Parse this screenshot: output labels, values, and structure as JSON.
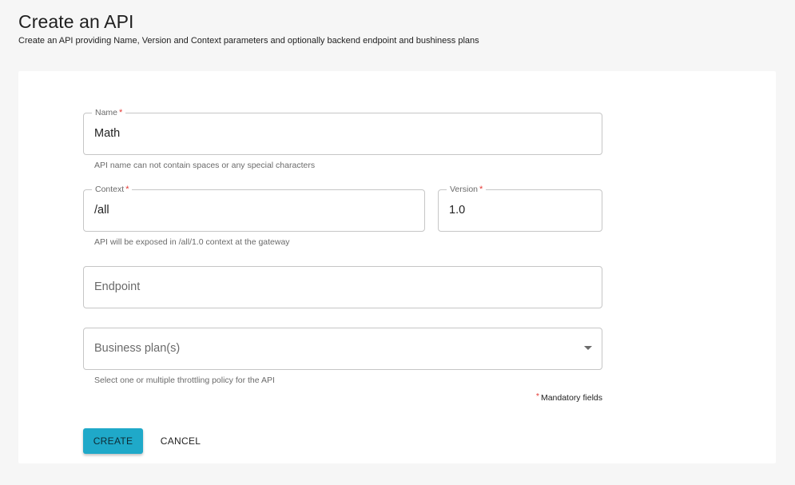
{
  "header": {
    "title": "Create an API",
    "subtitle": "Create an API providing Name, Version and Context parameters and optionally backend endpoint and bushiness plans"
  },
  "form": {
    "name": {
      "label": "Name",
      "required_mark": "*",
      "value": "Math",
      "helper": "API name can not contain spaces or any special characters"
    },
    "context": {
      "label": "Context",
      "required_mark": "*",
      "value": "/all",
      "helper": "API will be exposed in /all/1.0 context at the gateway"
    },
    "version": {
      "label": "Version",
      "required_mark": "*",
      "value": "1.0"
    },
    "endpoint": {
      "placeholder": "Endpoint",
      "value": ""
    },
    "business_plans": {
      "placeholder": "Business plan(s)",
      "helper": "Select one or multiple throttling policy for the API",
      "icon": "chevron-down-icon"
    },
    "mandatory_note": {
      "star": "*",
      "text": "Mandatory fields"
    }
  },
  "actions": {
    "create_label": "CREATE",
    "cancel_label": "CANCEL"
  },
  "colors": {
    "accent": "#1fa9c9",
    "required": "#e53935",
    "background": "#f6f6f6"
  }
}
